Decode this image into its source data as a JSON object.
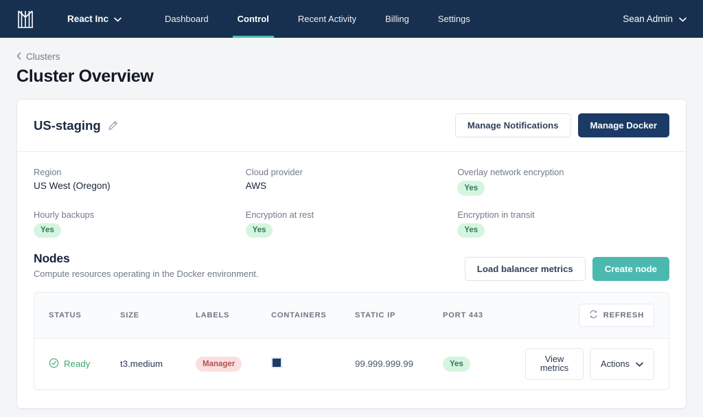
{
  "navbar": {
    "logo_icon": "monogram-m-logo",
    "org": {
      "label": "React Inc",
      "caret_icon": "chevron-down-icon"
    },
    "links": [
      {
        "label": "Dashboard",
        "active": false
      },
      {
        "label": "Control",
        "active": true
      },
      {
        "label": "Recent Activity",
        "active": false
      },
      {
        "label": "Billing",
        "active": false
      },
      {
        "label": "Settings",
        "active": false
      }
    ],
    "user": {
      "label": "Sean Admin",
      "caret_icon": "chevron-down-icon"
    },
    "background_color": "#18304f",
    "accent_color": "#49bfb5"
  },
  "page": {
    "breadcrumb": {
      "back_icon": "chevron-left-icon",
      "label": "Clusters"
    },
    "title": "Cluster Overview"
  },
  "cluster": {
    "name": "US-staging",
    "edit_icon": "pencil-icon",
    "actions": {
      "manage_notifications": "Manage Notifications",
      "manage_docker": "Manage Docker"
    },
    "fields": [
      {
        "label": "Region",
        "value": "US West (Oregon)",
        "type": "text"
      },
      {
        "label": "Cloud provider",
        "value": "AWS",
        "type": "text"
      },
      {
        "label": "Overlay network encryption",
        "value": "Yes",
        "type": "pill-green"
      },
      {
        "label": "Hourly backups",
        "value": "Yes",
        "type": "pill-green"
      },
      {
        "label": "Encryption at rest",
        "value": "Yes",
        "type": "pill-green"
      },
      {
        "label": "Encryption in transit",
        "value": "Yes",
        "type": "pill-green"
      }
    ]
  },
  "nodes": {
    "title": "Nodes",
    "subtitle": "Compute resources operating in the Docker environment.",
    "actions": {
      "load_balancer_metrics": "Load balancer metrics",
      "create_node": "Create node"
    },
    "table": {
      "columns": [
        "STATUS",
        "SIZE",
        "LABELS",
        "CONTAINERS",
        "STATIC IP",
        "PORT 443"
      ],
      "refresh_label": "REFRESH",
      "refresh_icon": "refresh-icon",
      "rows": [
        {
          "status": "Ready",
          "status_icon": "check-circle-icon",
          "size": "t3.medium",
          "label": "Manager",
          "label_style": "pill-red",
          "containers_icon": "container-square-icon",
          "static_ip": "99.999.999.99",
          "port443": "Yes",
          "port443_style": "pill-green",
          "view_metrics": "View metrics",
          "actions": "Actions",
          "actions_caret_icon": "chevron-down-icon"
        }
      ]
    }
  }
}
